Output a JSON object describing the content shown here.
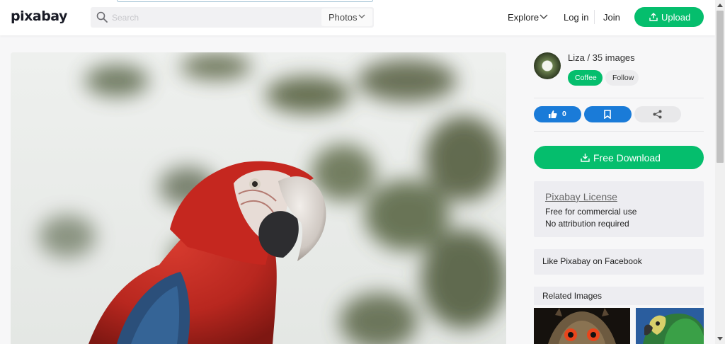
{
  "header": {
    "logo": "pixabay",
    "search": {
      "placeholder": "Search",
      "value": ""
    },
    "media_type": "Photos",
    "nav": {
      "explore": "Explore",
      "login": "Log in",
      "join": "Join",
      "upload": "Upload"
    }
  },
  "author": {
    "name_count": "Liza / 35 images",
    "coffee_label": "Coffee",
    "follow_label": "Follow"
  },
  "actions": {
    "like_count": "0"
  },
  "download": {
    "label": "Free Download"
  },
  "license": {
    "title": "Pixabay License",
    "line1": "Free for commercial use",
    "line2": "No attribution required"
  },
  "facebook": {
    "label": "Like Pixabay on Facebook"
  },
  "related": {
    "heading": "Related Images"
  },
  "colors": {
    "brand_green": "#05be6d",
    "action_blue": "#1a7bd8"
  },
  "icons": [
    "search-icon",
    "chevron-down-icon",
    "upload-icon",
    "thumbs-up-icon",
    "bookmark-icon",
    "share-icon",
    "download-icon"
  ]
}
